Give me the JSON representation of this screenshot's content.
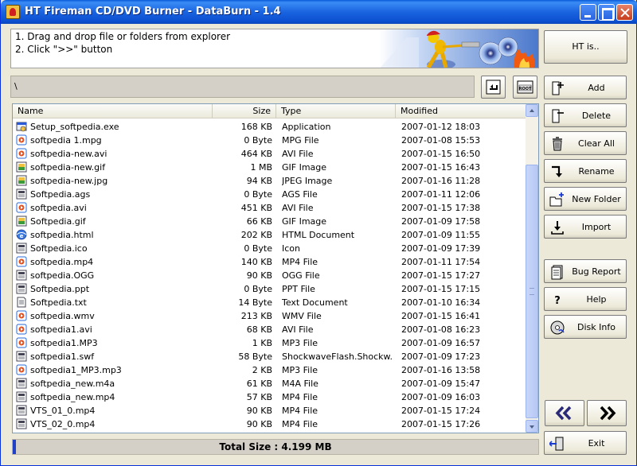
{
  "window": {
    "title": "HT Fireman CD/DVD Burner - DataBurn - 1.4"
  },
  "instructions": {
    "line1": "1. Drag and drop file or folders from explorer",
    "line2": "2. Click \">>\" button"
  },
  "ht_button": "HT is..",
  "path": "\\",
  "columns": {
    "name": "Name",
    "size": "Size",
    "type": "Type",
    "modified": "Modified"
  },
  "files": [
    {
      "name": "Setup_softpedia.exe",
      "size": "168 KB",
      "type": "Application",
      "modified": "2007-01-12 18:03",
      "icon": "exe-file-icon"
    },
    {
      "name": "softpedia 1.mpg",
      "size": "0 Byte",
      "type": "MPG File",
      "modified": "2007-01-08 15:53",
      "icon": "media-file-icon"
    },
    {
      "name": "softpedia-new.avi",
      "size": "464 KB",
      "type": "AVI File",
      "modified": "2007-01-15 16:50",
      "icon": "media-file-icon"
    },
    {
      "name": "softpedia-new.gif",
      "size": "1 MB",
      "type": "GIF Image",
      "modified": "2007-01-15 16:43",
      "icon": "image-file-icon"
    },
    {
      "name": "softpedia-new.jpg",
      "size": "94 KB",
      "type": "JPEG Image",
      "modified": "2007-01-16 11:28",
      "icon": "image-file-icon"
    },
    {
      "name": "Softpedia.ags",
      "size": "0 Byte",
      "type": "AGS File",
      "modified": "2007-01-11 12:06",
      "icon": "generic-file-icon"
    },
    {
      "name": "softpedia.avi",
      "size": "451 KB",
      "type": "AVI File",
      "modified": "2007-01-15 17:38",
      "icon": "media-file-icon"
    },
    {
      "name": "Softpedia.gif",
      "size": "66 KB",
      "type": "GIF Image",
      "modified": "2007-01-09 17:58",
      "icon": "image-file-icon"
    },
    {
      "name": "softpedia.html",
      "size": "202 KB",
      "type": "HTML Document",
      "modified": "2007-01-09 11:55",
      "icon": "html-file-icon"
    },
    {
      "name": "Softpedia.ico",
      "size": "0 Byte",
      "type": "Icon",
      "modified": "2007-01-09 17:39",
      "icon": "generic-file-icon"
    },
    {
      "name": "softpedia.mp4",
      "size": "140 KB",
      "type": "MP4 File",
      "modified": "2007-01-11 17:54",
      "icon": "media-file-icon"
    },
    {
      "name": "softpedia.OGG",
      "size": "90 KB",
      "type": "OGG File",
      "modified": "2007-01-15 17:27",
      "icon": "generic-file-icon"
    },
    {
      "name": "Softpedia.ppt",
      "size": "0 Byte",
      "type": "PPT File",
      "modified": "2007-01-15 17:15",
      "icon": "generic-file-icon"
    },
    {
      "name": "Softpedia.txt",
      "size": "14 Byte",
      "type": "Text Document",
      "modified": "2007-01-10 16:34",
      "icon": "text-file-icon"
    },
    {
      "name": "softpedia.wmv",
      "size": "213 KB",
      "type": "WMV File",
      "modified": "2007-01-15 16:41",
      "icon": "media-file-icon"
    },
    {
      "name": "softpedia1.avi",
      "size": "68 KB",
      "type": "AVI File",
      "modified": "2007-01-08 16:23",
      "icon": "media-file-icon"
    },
    {
      "name": "softpedia1.MP3",
      "size": "1 KB",
      "type": "MP3 File",
      "modified": "2007-01-09 16:57",
      "icon": "media-file-icon"
    },
    {
      "name": "softpedia1.swf",
      "size": "58 Byte",
      "type": "ShockwaveFlash.Shockw...",
      "modified": "2007-01-09 17:23",
      "icon": "generic-file-icon"
    },
    {
      "name": "softpedia1_MP3.mp3",
      "size": "2 KB",
      "type": "MP3 File",
      "modified": "2007-01-16 13:58",
      "icon": "media-file-icon"
    },
    {
      "name": "softpedia_new.m4a",
      "size": "61 KB",
      "type": "M4A File",
      "modified": "2007-01-09 15:47",
      "icon": "generic-file-icon"
    },
    {
      "name": "softpedia_new.mp4",
      "size": "57 KB",
      "type": "MP4 File",
      "modified": "2007-01-09 16:03",
      "icon": "generic-file-icon"
    },
    {
      "name": "VTS_01_0.mp4",
      "size": "90 KB",
      "type": "MP4 File",
      "modified": "2007-01-15 17:24",
      "icon": "generic-file-icon"
    },
    {
      "name": "VTS_02_0.mp4",
      "size": "90 KB",
      "type": "MP4 File",
      "modified": "2007-01-15 17:26",
      "icon": "generic-file-icon"
    }
  ],
  "sidebar": {
    "add": "Add",
    "delete": "Delete",
    "clear_all": "Clear All",
    "rename": "Rename",
    "new_folder": "New Folder",
    "import": "Import",
    "bug_report": "Bug Report",
    "help": "Help",
    "disk_info": "Disk Info",
    "exit": "Exit"
  },
  "status": {
    "total_size": "Total Size : 4.199 MB"
  },
  "colors": {
    "titlebar": "#0a5ad8",
    "accent": "#2040c8",
    "nav_arrows": "#2a2a78"
  }
}
